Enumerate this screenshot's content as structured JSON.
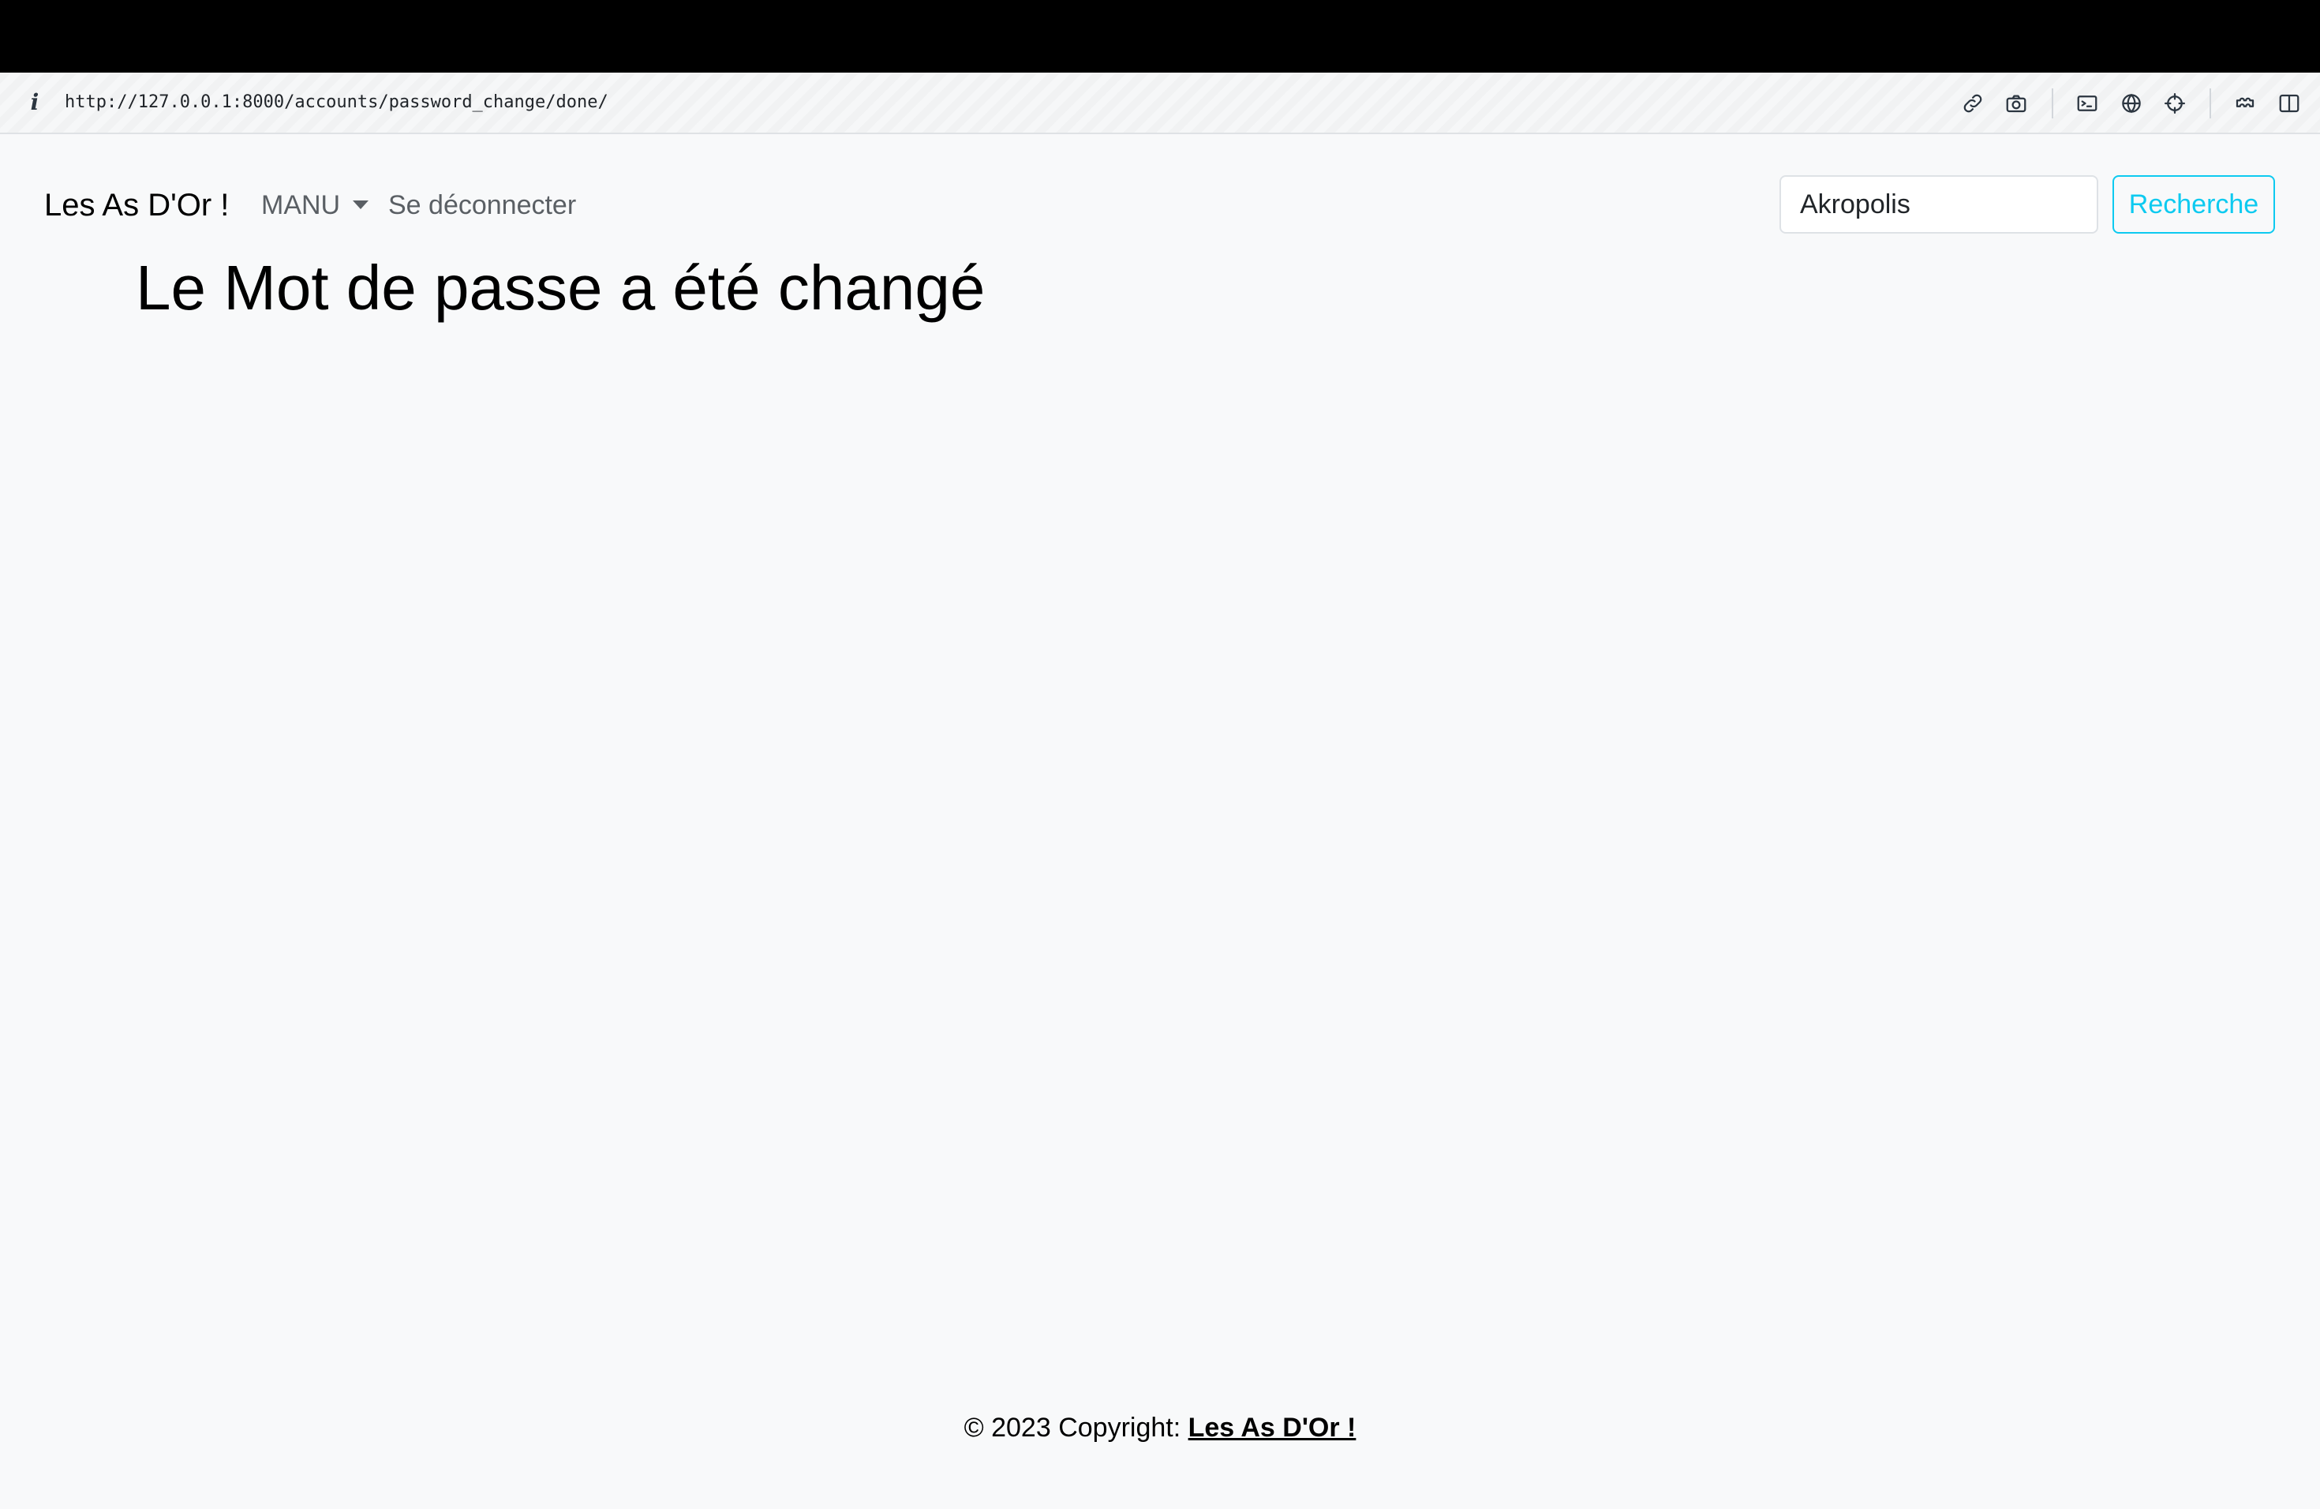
{
  "browser": {
    "url": "http://127.0.0.1:8000/accounts/password_change/done/",
    "toolbar_icons": [
      "link-icon",
      "camera-icon",
      "terminal-icon",
      "globe-icon",
      "crosshair-icon",
      "extensions-icon",
      "sidebar-icon"
    ]
  },
  "navbar": {
    "brand": "Les As D'Or !",
    "user_menu_label": "MANU",
    "logout_label": "Se déconnecter",
    "search": {
      "value": "Akropolis",
      "button_label": "Recherche"
    }
  },
  "main": {
    "title": "Le Mot de passe a été changé"
  },
  "footer": {
    "copyright_text": "© 2023 Copyright: ",
    "link_label": "Les As D'Or !"
  },
  "colors": {
    "page_background": "#f8f9fa",
    "search_button_accent": "#0dcaf0",
    "nav_text": "#5a5f64"
  }
}
